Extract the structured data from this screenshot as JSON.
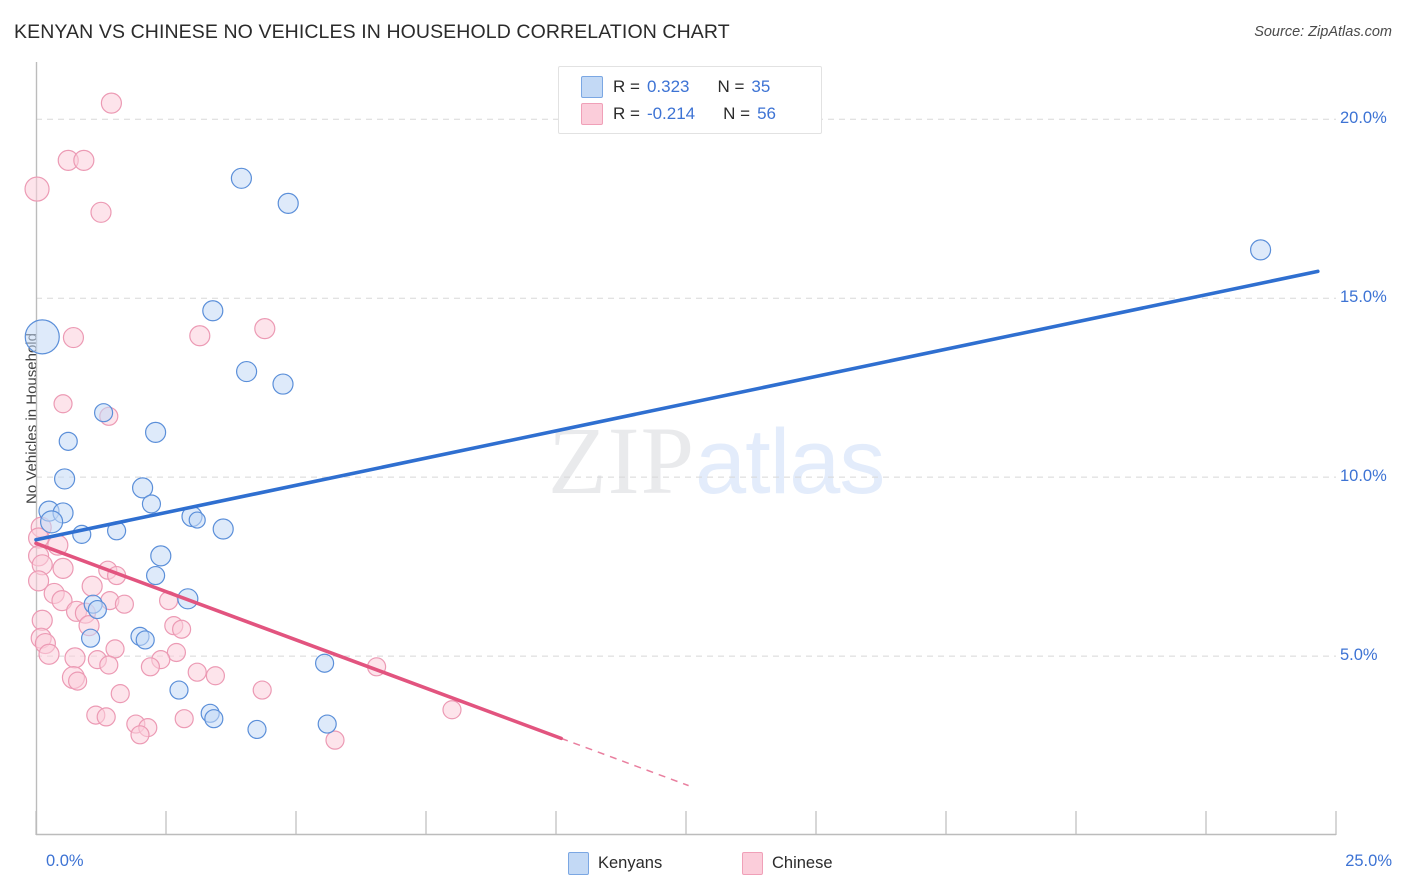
{
  "header": {
    "title": "KENYAN VS CHINESE NO VEHICLES IN HOUSEHOLD CORRELATION CHART",
    "source": "Source: ZipAtlas.com"
  },
  "watermark": {
    "part1": "ZIP",
    "part2": "atlas"
  },
  "stats_legend": {
    "rows": [
      {
        "r_label": "R =",
        "r_value": "0.323",
        "n_label": "N =",
        "n_value": "35",
        "color": "#c3d9f5"
      },
      {
        "r_label": "R =",
        "r_value": "-0.214",
        "n_label": "N =",
        "n_value": "56",
        "color": "#fbcdda"
      }
    ]
  },
  "bottom_legend": {
    "kenyans": "Kenyans",
    "chinese": "Chinese"
  },
  "colors": {
    "blue_fill": "#c3d9f5",
    "blue_stroke": "#5b8fd9",
    "pink_fill": "#fbcdda",
    "pink_stroke": "#ec9ab4",
    "blue_line": "#2f6fd0",
    "pink_line": "#e2547f",
    "axis": "#bcbcbc",
    "grid": "#d8d8d8",
    "tick_text": "#3d73d4"
  },
  "chart_data": {
    "type": "scatter",
    "title": "KENYAN VS CHINESE NO VEHICLES IN HOUSEHOLD CORRELATION CHART",
    "xlabel": "",
    "ylabel": "No Vehicles in Household",
    "xlim": [
      0,
      25
    ],
    "ylim": [
      0,
      21.6
    ],
    "grid": true,
    "x_ticks": [
      "0.0%",
      "25.0%"
    ],
    "x_tick_values": [
      0,
      25
    ],
    "y_ticks": [
      "5.0%",
      "10.0%",
      "15.0%",
      "20.0%"
    ],
    "y_tick_values": [
      5,
      10,
      15,
      20
    ],
    "legend_position": "bottom-center",
    "series": [
      {
        "name": "Kenyans",
        "color": "#c3d9f5",
        "stroke": "#5b8fd9",
        "R": 0.323,
        "N": 35,
        "trend": {
          "x0": 0.0,
          "y0": 8.25,
          "x1": 24.65,
          "y1": 15.75,
          "color": "#2f6fd0"
        },
        "points": [
          {
            "x": 0.12,
            "y": 13.92,
            "r": 17
          },
          {
            "x": 23.55,
            "y": 16.35,
            "r": 10
          },
          {
            "x": 3.95,
            "y": 18.35,
            "r": 10
          },
          {
            "x": 4.85,
            "y": 17.65,
            "r": 10
          },
          {
            "x": 3.4,
            "y": 14.65,
            "r": 10
          },
          {
            "x": 4.05,
            "y": 12.95,
            "r": 10
          },
          {
            "x": 4.75,
            "y": 12.6,
            "r": 10
          },
          {
            "x": 1.3,
            "y": 11.8,
            "r": 9
          },
          {
            "x": 2.3,
            "y": 11.25,
            "r": 10
          },
          {
            "x": 0.62,
            "y": 11.0,
            "r": 9
          },
          {
            "x": 0.55,
            "y": 9.95,
            "r": 10
          },
          {
            "x": 2.05,
            "y": 9.7,
            "r": 10
          },
          {
            "x": 2.22,
            "y": 9.25,
            "r": 9
          },
          {
            "x": 0.25,
            "y": 9.05,
            "r": 10
          },
          {
            "x": 0.52,
            "y": 9.0,
            "r": 10
          },
          {
            "x": 0.3,
            "y": 8.75,
            "r": 11
          },
          {
            "x": 3.0,
            "y": 8.9,
            "r": 10
          },
          {
            "x": 3.1,
            "y": 8.8,
            "r": 8
          },
          {
            "x": 3.6,
            "y": 8.55,
            "r": 10
          },
          {
            "x": 1.55,
            "y": 8.5,
            "r": 9
          },
          {
            "x": 0.88,
            "y": 8.4,
            "r": 9
          },
          {
            "x": 2.4,
            "y": 7.8,
            "r": 10
          },
          {
            "x": 2.3,
            "y": 7.25,
            "r": 9
          },
          {
            "x": 2.92,
            "y": 6.6,
            "r": 10
          },
          {
            "x": 1.1,
            "y": 6.45,
            "r": 9
          },
          {
            "x": 1.18,
            "y": 6.3,
            "r": 9
          },
          {
            "x": 1.05,
            "y": 5.5,
            "r": 9
          },
          {
            "x": 2.0,
            "y": 5.55,
            "r": 9
          },
          {
            "x": 2.1,
            "y": 5.45,
            "r": 9
          },
          {
            "x": 5.55,
            "y": 4.8,
            "r": 9
          },
          {
            "x": 2.75,
            "y": 4.05,
            "r": 9
          },
          {
            "x": 3.35,
            "y": 3.4,
            "r": 9
          },
          {
            "x": 3.42,
            "y": 3.25,
            "r": 9
          },
          {
            "x": 5.6,
            "y": 3.1,
            "r": 9
          },
          {
            "x": 4.25,
            "y": 2.95,
            "r": 9
          }
        ]
      },
      {
        "name": "Chinese",
        "color": "#fbcdda",
        "stroke": "#ec9ab4",
        "R": -0.214,
        "N": 56,
        "trend": {
          "x0": 0.0,
          "y0": 8.15,
          "x1": 10.1,
          "y1": 2.7,
          "color": "#e2547f",
          "dash_x0": 10.1,
          "dash_y0": 2.7,
          "dash_x1": 12.55,
          "dash_y1": 1.38
        },
        "points": [
          {
            "x": 1.45,
            "y": 20.45,
            "r": 10
          },
          {
            "x": 0.62,
            "y": 18.85,
            "r": 10
          },
          {
            "x": 0.92,
            "y": 18.85,
            "r": 10
          },
          {
            "x": 0.02,
            "y": 18.05,
            "r": 12
          },
          {
            "x": 1.25,
            "y": 17.4,
            "r": 10
          },
          {
            "x": 4.4,
            "y": 14.15,
            "r": 10
          },
          {
            "x": 3.15,
            "y": 13.95,
            "r": 10
          },
          {
            "x": 0.72,
            "y": 13.9,
            "r": 10
          },
          {
            "x": 0.52,
            "y": 12.05,
            "r": 9
          },
          {
            "x": 1.4,
            "y": 11.7,
            "r": 9
          },
          {
            "x": 0.1,
            "y": 8.6,
            "r": 10
          },
          {
            "x": 0.05,
            "y": 8.3,
            "r": 10
          },
          {
            "x": 0.42,
            "y": 8.1,
            "r": 10
          },
          {
            "x": 0.05,
            "y": 7.8,
            "r": 10
          },
          {
            "x": 0.12,
            "y": 7.55,
            "r": 10
          },
          {
            "x": 0.52,
            "y": 7.45,
            "r": 10
          },
          {
            "x": 1.38,
            "y": 7.4,
            "r": 9
          },
          {
            "x": 1.55,
            "y": 7.25,
            "r": 9
          },
          {
            "x": 0.05,
            "y": 7.1,
            "r": 10
          },
          {
            "x": 1.08,
            "y": 6.95,
            "r": 10
          },
          {
            "x": 0.35,
            "y": 6.75,
            "r": 10
          },
          {
            "x": 0.5,
            "y": 6.55,
            "r": 10
          },
          {
            "x": 1.42,
            "y": 6.55,
            "r": 9
          },
          {
            "x": 2.55,
            "y": 6.55,
            "r": 9
          },
          {
            "x": 1.7,
            "y": 6.45,
            "r": 9
          },
          {
            "x": 0.78,
            "y": 6.25,
            "r": 10
          },
          {
            "x": 0.95,
            "y": 6.2,
            "r": 10
          },
          {
            "x": 0.12,
            "y": 6.0,
            "r": 10
          },
          {
            "x": 1.02,
            "y": 5.85,
            "r": 10
          },
          {
            "x": 2.65,
            "y": 5.85,
            "r": 9
          },
          {
            "x": 2.8,
            "y": 5.75,
            "r": 9
          },
          {
            "x": 0.1,
            "y": 5.5,
            "r": 10
          },
          {
            "x": 0.18,
            "y": 5.35,
            "r": 10
          },
          {
            "x": 1.52,
            "y": 5.2,
            "r": 9
          },
          {
            "x": 2.7,
            "y": 5.1,
            "r": 9
          },
          {
            "x": 0.25,
            "y": 5.05,
            "r": 10
          },
          {
            "x": 0.75,
            "y": 4.95,
            "r": 10
          },
          {
            "x": 1.18,
            "y": 4.9,
            "r": 9
          },
          {
            "x": 2.4,
            "y": 4.9,
            "r": 9
          },
          {
            "x": 1.4,
            "y": 4.75,
            "r": 9
          },
          {
            "x": 2.2,
            "y": 4.7,
            "r": 9
          },
          {
            "x": 6.55,
            "y": 4.7,
            "r": 9
          },
          {
            "x": 3.1,
            "y": 4.55,
            "r": 9
          },
          {
            "x": 3.45,
            "y": 4.45,
            "r": 9
          },
          {
            "x": 0.72,
            "y": 4.4,
            "r": 11
          },
          {
            "x": 0.8,
            "y": 4.3,
            "r": 9
          },
          {
            "x": 4.35,
            "y": 4.05,
            "r": 9
          },
          {
            "x": 1.62,
            "y": 3.95,
            "r": 9
          },
          {
            "x": 8.0,
            "y": 3.5,
            "r": 9
          },
          {
            "x": 1.15,
            "y": 3.35,
            "r": 9
          },
          {
            "x": 1.35,
            "y": 3.3,
            "r": 9
          },
          {
            "x": 2.85,
            "y": 3.25,
            "r": 9
          },
          {
            "x": 1.92,
            "y": 3.1,
            "r": 9
          },
          {
            "x": 2.15,
            "y": 3.0,
            "r": 9
          },
          {
            "x": 2.0,
            "y": 2.8,
            "r": 9
          },
          {
            "x": 5.75,
            "y": 2.65,
            "r": 9
          }
        ]
      }
    ]
  }
}
